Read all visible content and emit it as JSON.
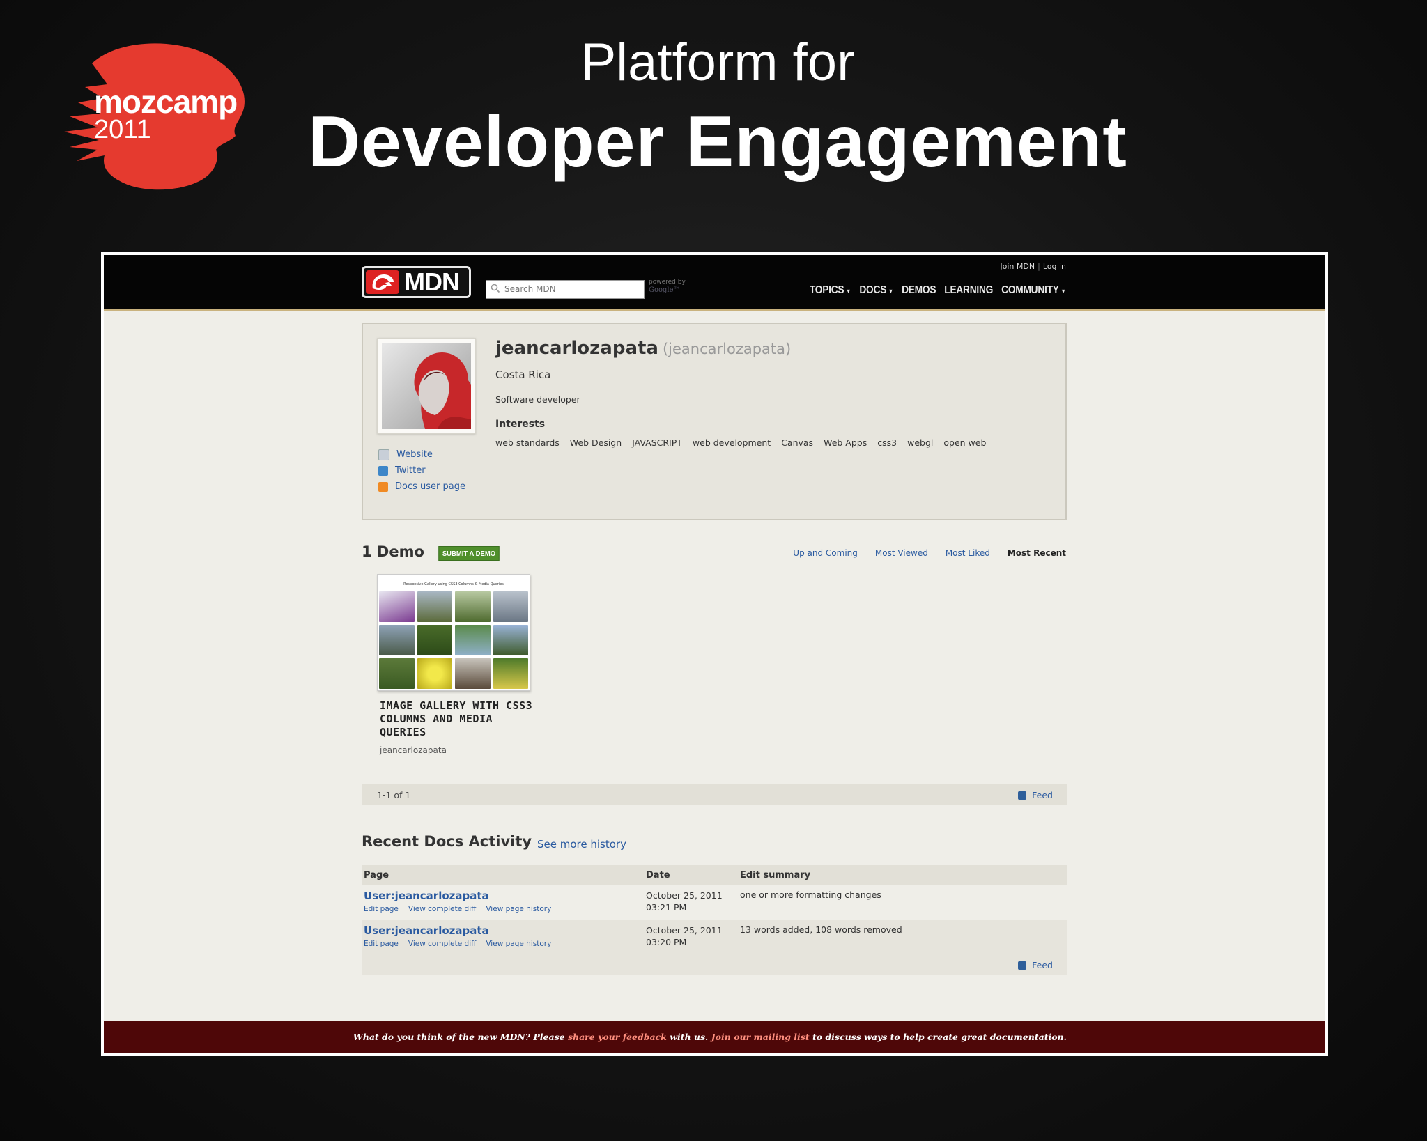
{
  "slide": {
    "logo_word": "mozcamp",
    "logo_year": "2011",
    "title_line1": "Platform for",
    "title_line2": "Developer Engagement"
  },
  "colors": {
    "logo_red": "#e53a2f",
    "header_bg": "#050505",
    "page_bg": "#efeee8",
    "link_blue": "#2a5aa0",
    "submit_green": "#4f8f2b",
    "footer_bg": "#4e0708",
    "footer_link": "#ff8f7f"
  },
  "header": {
    "logo_text": "MDN",
    "search_placeholder": "Search MDN",
    "powered_by": "powered by",
    "powered_brand": "Google™",
    "join": "Join MDN",
    "login": "Log in",
    "nav": [
      {
        "label": "TOPICS",
        "dropdown": true
      },
      {
        "label": "DOCS",
        "dropdown": true
      },
      {
        "label": "DEMOS",
        "dropdown": false
      },
      {
        "label": "LEARNING",
        "dropdown": false
      },
      {
        "label": "COMMUNITY",
        "dropdown": true
      }
    ]
  },
  "profile": {
    "username": "jeancarlozapata",
    "handle": "(jeancarlozapata)",
    "location": "Costa Rica",
    "bio": "Software developer",
    "interests_heading": "Interests",
    "interests": [
      "web standards",
      "Web Design",
      "JAVASCRIPT",
      "web development",
      "Canvas",
      "Web Apps",
      "css3",
      "webgl",
      "open web"
    ],
    "links": [
      {
        "label": "Website",
        "icon": "globe-icon"
      },
      {
        "label": "Twitter",
        "icon": "twitter-icon"
      },
      {
        "label": "Docs user page",
        "icon": "pencil-icon"
      }
    ]
  },
  "demos": {
    "heading": "1 Demo",
    "submit_label": "SUBMIT A DEMO",
    "filters": [
      "Up and Coming",
      "Most Viewed",
      "Most Liked",
      "Most Recent"
    ],
    "active_filter": "Most Recent",
    "items": [
      {
        "thumb_title": "Responsive Gallery using CSS3 Columns & Media Queries",
        "title": "IMAGE GALLERY WITH CSS3 COLUMNS AND MEDIA QUERIES",
        "author": "jeancarlozapata"
      }
    ],
    "pager": "1-1 of 1",
    "feed": "Feed"
  },
  "activity": {
    "heading": "Recent Docs Activity",
    "see_more": "See more history",
    "columns": [
      "Page",
      "Date",
      "Edit summary"
    ],
    "rows": [
      {
        "page": "User:jeancarlozapata",
        "links": [
          "Edit page",
          "View complete diff",
          "View page history"
        ],
        "date1": "October 25, 2011",
        "date2": "03:21 PM",
        "summary": "one or more formatting changes"
      },
      {
        "page": "User:jeancarlozapata",
        "links": [
          "Edit page",
          "View complete diff",
          "View page history"
        ],
        "date1": "October 25, 2011",
        "date2": "03:20 PM",
        "summary": "13 words added, 108 words removed"
      }
    ],
    "feed": "Feed"
  },
  "footer": {
    "part1": "What do you think of the new MDN? Please ",
    "link1": "share your feedback",
    "part2": " with us. ",
    "link2": "Join our mailing list",
    "part3": " to discuss ways to help create great documentation."
  }
}
